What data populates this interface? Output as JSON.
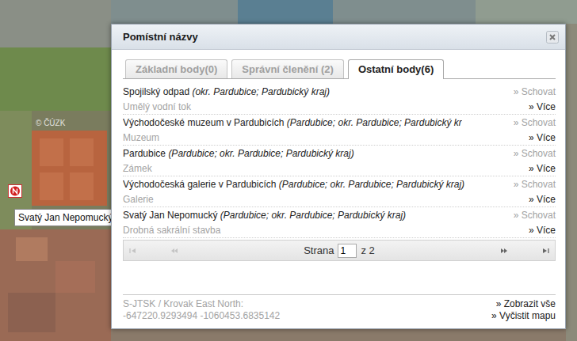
{
  "map": {
    "copyright": "© ČÚZK",
    "tooltip": "Svatý Jan Nepomucký"
  },
  "window": {
    "title": "Pomístní názvy"
  },
  "tabs": [
    {
      "label": "Základní body(0)",
      "selected": false
    },
    {
      "label": "Správní členění (2)",
      "selected": false
    },
    {
      "label": "Ostatní body(6)",
      "selected": true
    }
  ],
  "items": [
    {
      "name": "Spojilský odpad ",
      "context": "(okr. Pardubice; Pardubický kraj)",
      "type": "Umělý vodní tok",
      "hide": "» Schovat",
      "more": "» Více"
    },
    {
      "name": "Východočeské muzeum v Pardubicích ",
      "context": "(Pardubice; okr. Pardubice; Pardubický kr",
      "type": "Muzeum",
      "hide": "» Schovat",
      "more": "» Více"
    },
    {
      "name": "Pardubice ",
      "context": "(Pardubice; okr. Pardubice; Pardubický kraj)",
      "type": "Zámek",
      "hide": "» Schovat",
      "more": "» Více"
    },
    {
      "name": "Východočeská galerie v Pardubicích ",
      "context": "(Pardubice; okr. Pardubice; Pardubický kraj)",
      "type": "Galerie",
      "hide": "» Schovat",
      "more": "» Více"
    },
    {
      "name": "Svatý Jan Nepomucký ",
      "context": "(Pardubice; okr. Pardubice; Pardubický kraj)",
      "type": "Drobná sakrální stavba",
      "hide": "» Schovat",
      "more": "» Více"
    }
  ],
  "pager": {
    "label": "Strana",
    "page": "1",
    "of": "z 2",
    "buttons": [
      {
        "kind": "first",
        "disabled": true
      },
      {
        "kind": "prev",
        "disabled": true
      },
      {
        "kind": "next",
        "disabled": false
      },
      {
        "kind": "last",
        "disabled": false
      }
    ]
  },
  "footer": {
    "crs": "S-JTSK / Krovak East North:",
    "coords": "-647220.9293494 -1060453.6835142",
    "links": [
      "» Zobrazit vše",
      "» Vyčistit mapu"
    ]
  }
}
